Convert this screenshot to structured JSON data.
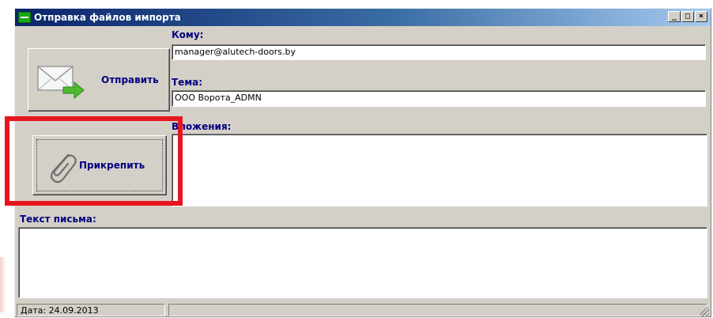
{
  "window": {
    "title": "Отправка файлов импорта",
    "controls": {
      "minimize": "_",
      "maximize": "□",
      "close": "×"
    }
  },
  "send_button": {
    "label": "Отправить",
    "icon": "envelope-arrow-icon"
  },
  "attach_button": {
    "label": "Прикрепить",
    "icon": "paperclip-icon"
  },
  "fields": {
    "to": {
      "label": "Кому:",
      "value": "manager@alutech-doors.by"
    },
    "subject": {
      "label": "Тема:",
      "value": "ООО Ворота_ADMN"
    },
    "attachments": {
      "label": "Вложения:"
    },
    "body": {
      "label": "Текст письма:",
      "value": ""
    }
  },
  "status": {
    "date": "Дата: 24.09.2013",
    "second": ""
  },
  "colors": {
    "highlight": "#e8141e",
    "label_blue": "#000080",
    "window_bg": "#d4d0c8"
  }
}
